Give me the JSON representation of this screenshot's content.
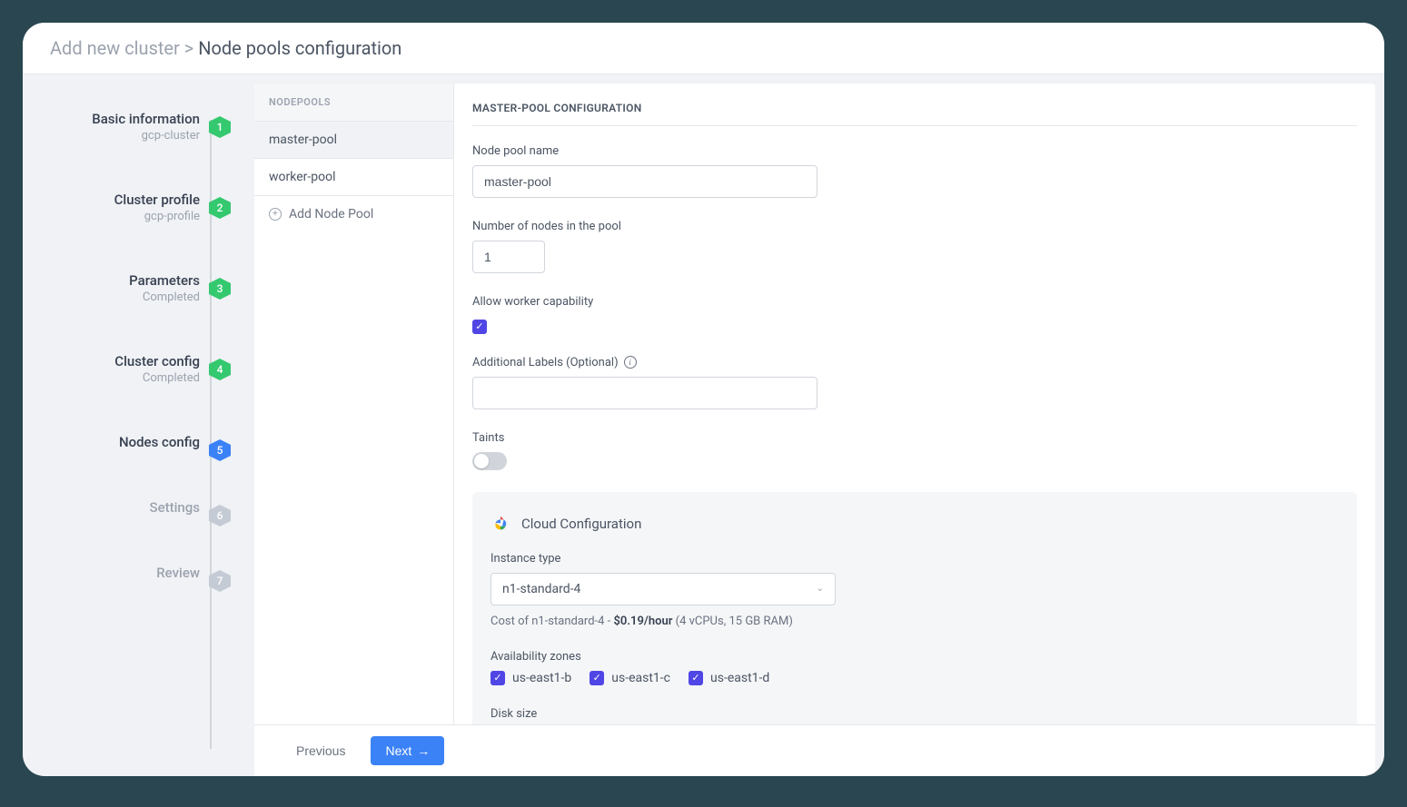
{
  "breadcrumb": {
    "root": "Add new cluster",
    "sep": ">",
    "current": "Node pools configuration"
  },
  "steps": [
    {
      "num": "1",
      "title": "Basic information",
      "sub": "gcp-cluster",
      "state": "done"
    },
    {
      "num": "2",
      "title": "Cluster profile",
      "sub": "gcp-profile",
      "state": "done"
    },
    {
      "num": "3",
      "title": "Parameters",
      "sub": "Completed",
      "state": "done"
    },
    {
      "num": "4",
      "title": "Cluster config",
      "sub": "Completed",
      "state": "done"
    },
    {
      "num": "5",
      "title": "Nodes config",
      "sub": "",
      "state": "active"
    },
    {
      "num": "6",
      "title": "Settings",
      "sub": "",
      "state": "pending"
    },
    {
      "num": "7",
      "title": "Review",
      "sub": "",
      "state": "pending"
    }
  ],
  "pools": {
    "header": "NODEPOOLS",
    "items": [
      "master-pool",
      "worker-pool"
    ],
    "add_label": "Add Node Pool"
  },
  "form": {
    "title": "MASTER-POOL CONFIGURATION",
    "pool_name_label": "Node pool name",
    "pool_name_value": "master-pool",
    "node_count_label": "Number of nodes in the pool",
    "node_count_value": "1",
    "worker_cap_label": "Allow worker capability",
    "labels_label": "Additional Labels (Optional)",
    "taints_label": "Taints"
  },
  "cloud": {
    "title": "Cloud Configuration",
    "instance_label": "Instance type",
    "instance_value": "n1-standard-4",
    "cost_prefix": "Cost of n1-standard-4 - ",
    "cost_bold": "$0.19/hour",
    "cost_suffix": " (4 vCPUs, 15 GB RAM)",
    "zones_label": "Availability zones",
    "zones": [
      "us-east1-b",
      "us-east1-c",
      "us-east1-d"
    ],
    "disk_label": "Disk size"
  },
  "footer": {
    "prev": "Previous",
    "next": "Next"
  }
}
